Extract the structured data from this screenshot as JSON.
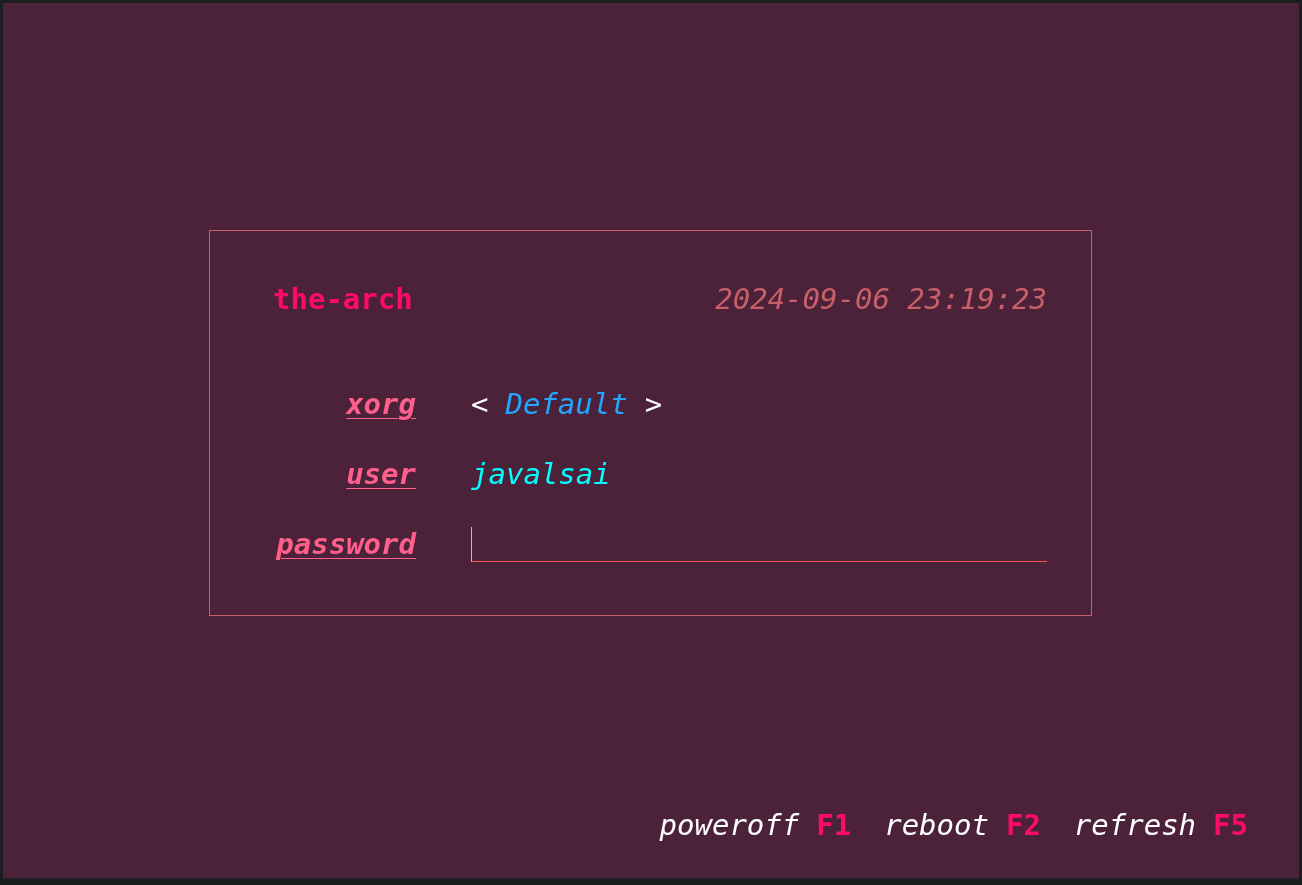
{
  "hostname": "the-arch",
  "clock": "2024-09-06 23:19:23",
  "rows": [
    {
      "kind": "selector",
      "label": "xorg",
      "prev": "<",
      "value": "Default",
      "next": ">"
    },
    {
      "kind": "text",
      "label": "user",
      "value": "javalsai"
    },
    {
      "kind": "password",
      "label": "password",
      "focused": true
    }
  ],
  "actions": [
    {
      "label": "poweroff",
      "key": "F1"
    },
    {
      "label": "reboot",
      "key": "F2"
    },
    {
      "label": "refresh",
      "key": "F5"
    }
  ]
}
